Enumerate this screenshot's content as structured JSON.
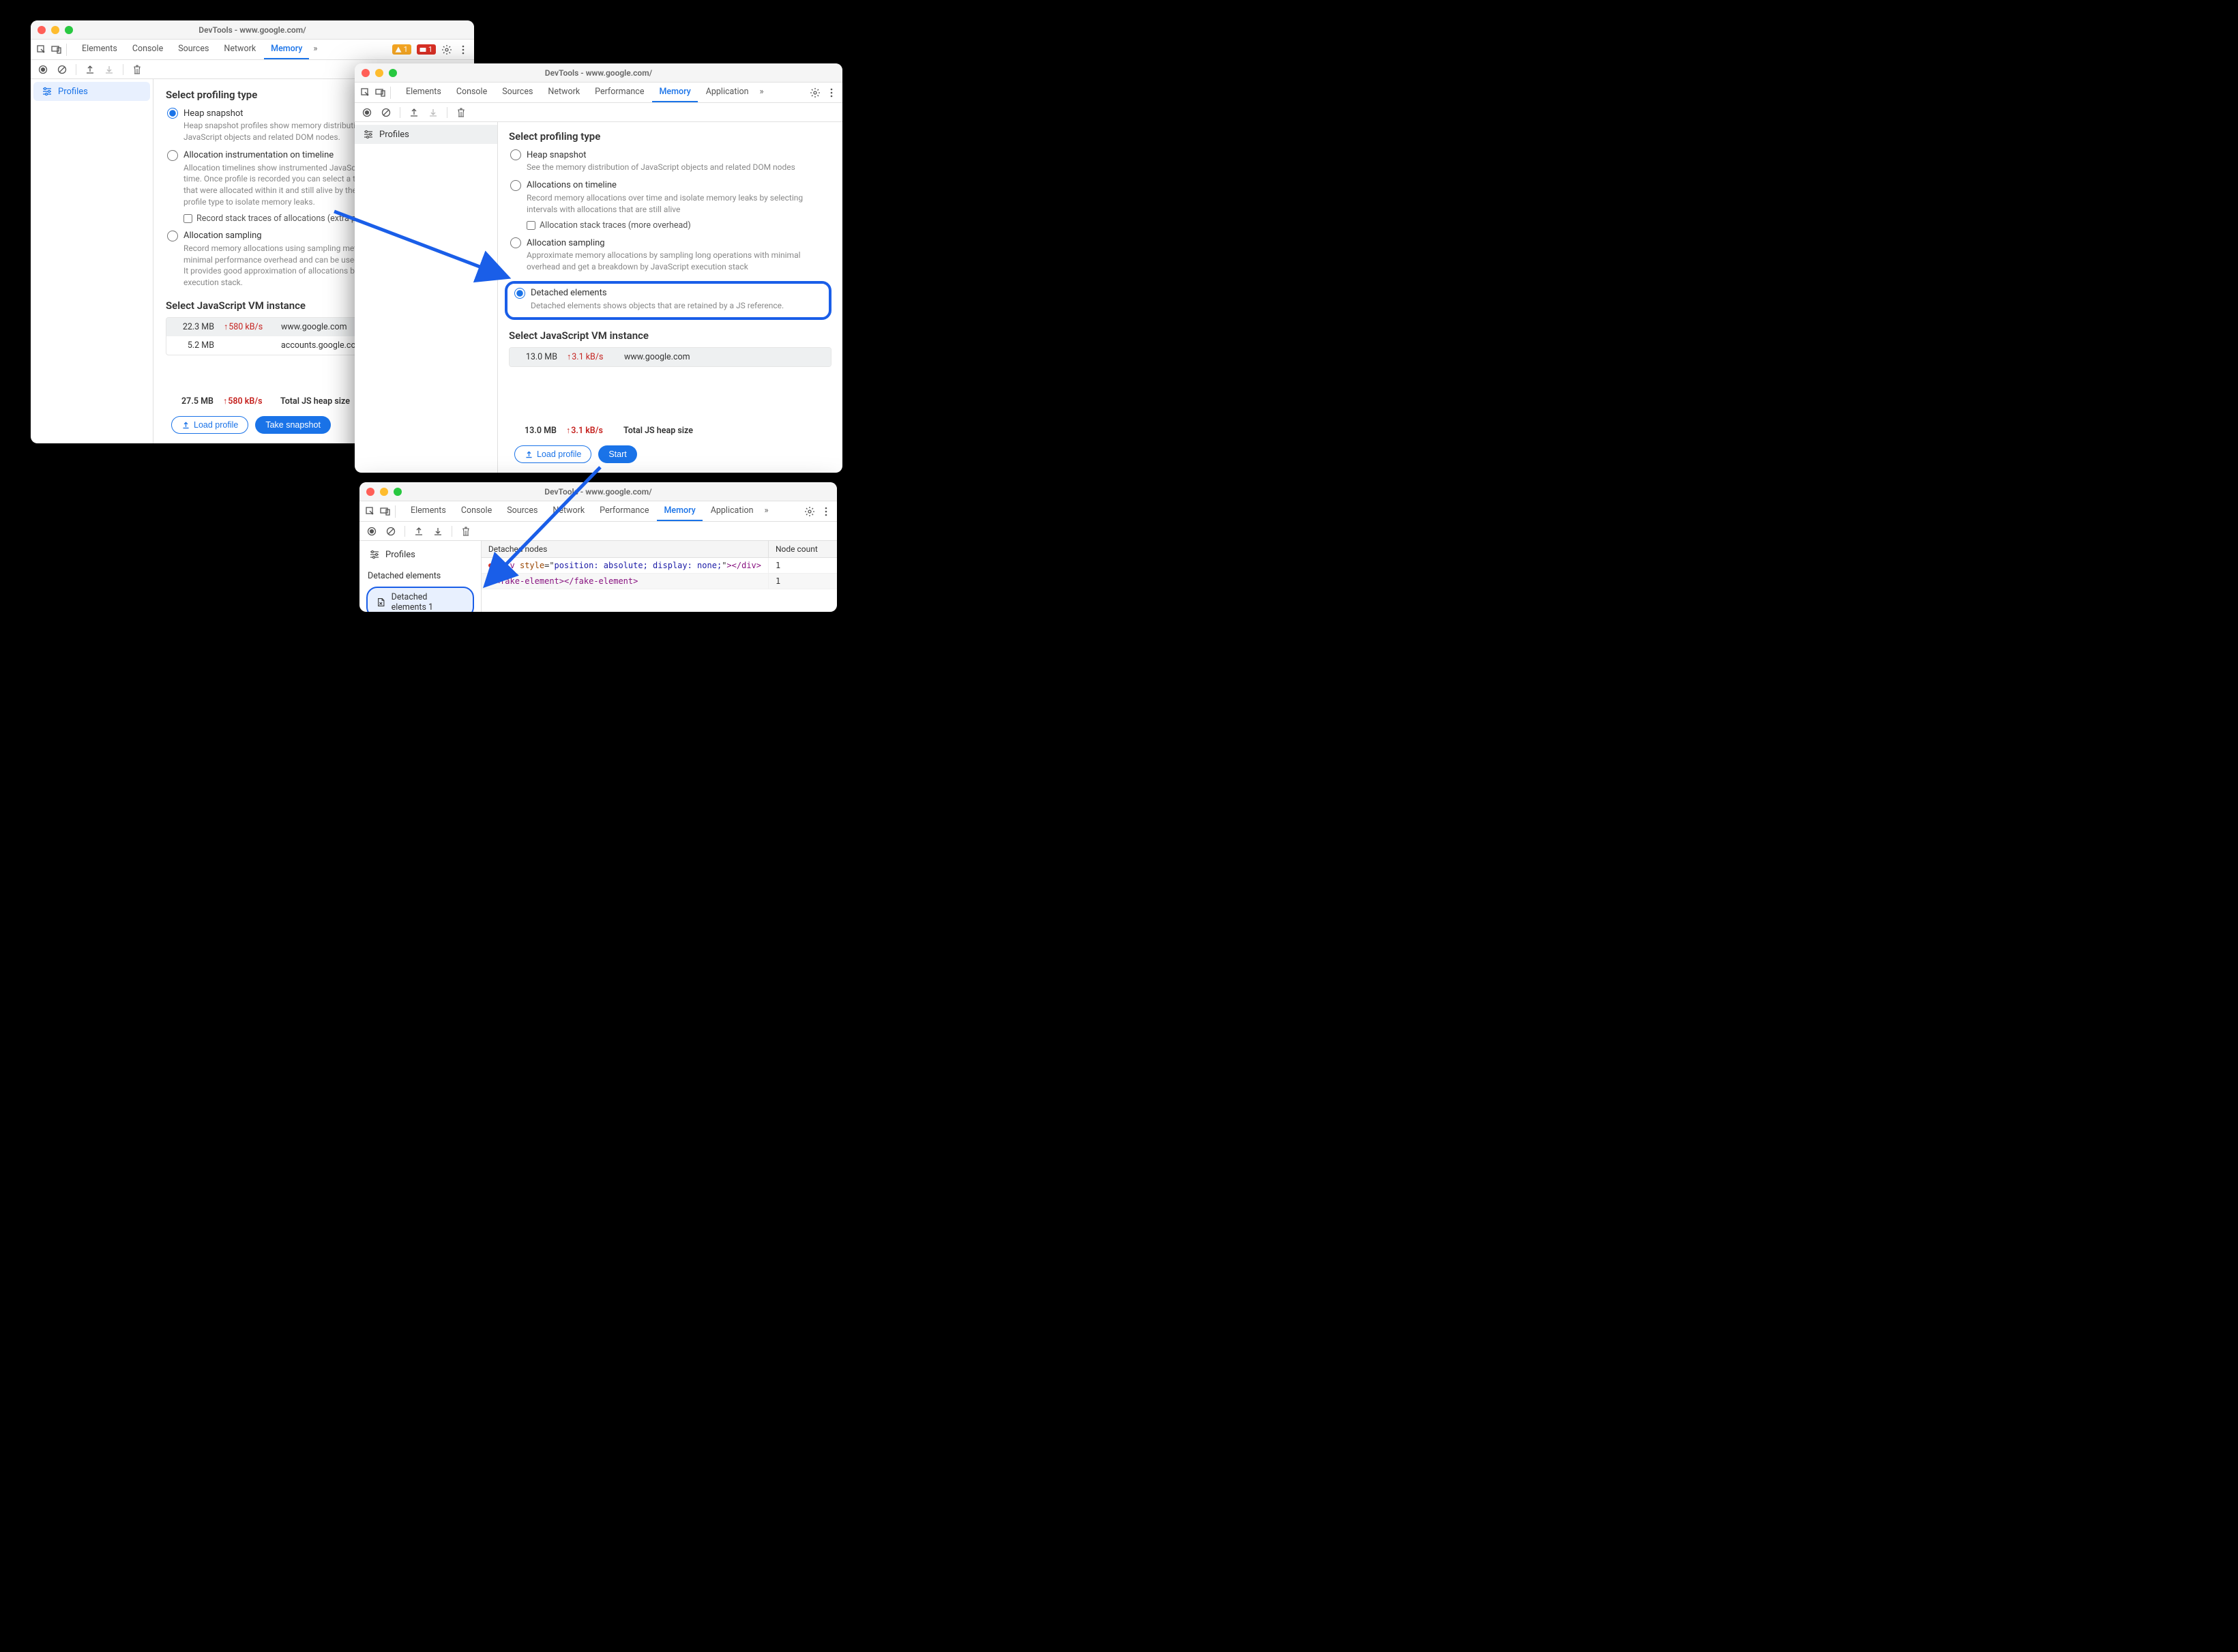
{
  "w1": {
    "title": "DevTools - www.google.com/",
    "tabs": [
      "Elements",
      "Console",
      "Sources",
      "Network",
      "Memory"
    ],
    "activeTab": "Memory",
    "warnCount": "1",
    "errCount": "1",
    "sidebar": {
      "profiles": "Profiles"
    },
    "heading": "Select profiling type",
    "opts": {
      "heap": {
        "label": "Heap snapshot",
        "desc": "Heap snapshot profiles show memory distribution among your page's JavaScript objects and related DOM nodes."
      },
      "timeline": {
        "label": "Allocation instrumentation on timeline",
        "desc": "Allocation timelines show instrumented JavaScript memory allocations over time. Once profile is recorded you can select a time interval to see objects that were allocated within it and still alive by the end of recording. Use this profile type to isolate memory leaks.",
        "check": "Record stack traces of allocations (extra performance overhead)"
      },
      "sampling": {
        "label": "Allocation sampling",
        "desc": "Record memory allocations using sampling method. This profile type has minimal performance overhead and can be used for long running operations. It provides good approximation of allocations broken down by JavaScript execution stack."
      }
    },
    "vm": {
      "heading": "Select JavaScript VM instance",
      "rows": [
        {
          "size": "22.3 MB",
          "rate": "580 kB/s",
          "host": "www.google.com"
        },
        {
          "size": "5.2 MB",
          "rate": "",
          "host": "accounts.google.com: RotateCookiesPage"
        }
      ],
      "total": {
        "size": "27.5 MB",
        "rate": "580 kB/s",
        "label": "Total JS heap size"
      }
    },
    "btns": {
      "load": "Load profile",
      "snap": "Take snapshot"
    }
  },
  "w2": {
    "title": "DevTools - www.google.com/",
    "tabs": [
      "Elements",
      "Console",
      "Sources",
      "Network",
      "Performance",
      "Memory",
      "Application"
    ],
    "activeTab": "Memory",
    "sidebar": {
      "profiles": "Profiles"
    },
    "heading": "Select profiling type",
    "opts": {
      "heap": {
        "label": "Heap snapshot",
        "desc": "See the memory distribution of JavaScript objects and related DOM nodes"
      },
      "timeline": {
        "label": "Allocations on timeline",
        "desc": "Record memory allocations over time and isolate memory leaks by selecting intervals with allocations that are still alive",
        "check": "Allocation stack traces (more overhead)"
      },
      "sampling": {
        "label": "Allocation sampling",
        "desc": "Approximate memory allocations by sampling long operations with minimal overhead and get a breakdown by JavaScript execution stack"
      },
      "detached": {
        "label": "Detached elements",
        "desc": "Detached elements shows objects that are retained by a JS reference."
      }
    },
    "vm": {
      "heading": "Select JavaScript VM instance",
      "rows": [
        {
          "size": "13.0 MB",
          "rate": "3.1 kB/s",
          "host": "www.google.com"
        }
      ],
      "total": {
        "size": "13.0 MB",
        "rate": "3.1 kB/s",
        "label": "Total JS heap size"
      }
    },
    "btns": {
      "load": "Load profile",
      "start": "Start"
    }
  },
  "w3": {
    "title": "DevTools - www.google.com/",
    "tabs": [
      "Elements",
      "Console",
      "Sources",
      "Network",
      "Performance",
      "Memory",
      "Application"
    ],
    "activeTab": "Memory",
    "sidebar": {
      "profiles": "Profiles",
      "cat": "Detached elements",
      "run": "Detached elements 1"
    },
    "head": {
      "c1": "Detached nodes",
      "c2": "Node count"
    },
    "rows": [
      {
        "html": "<div style=\"position: absolute; display: none;\"></div>",
        "count": "1"
      },
      {
        "html": "<fake-element></fake-element>",
        "count": "1"
      }
    ]
  }
}
